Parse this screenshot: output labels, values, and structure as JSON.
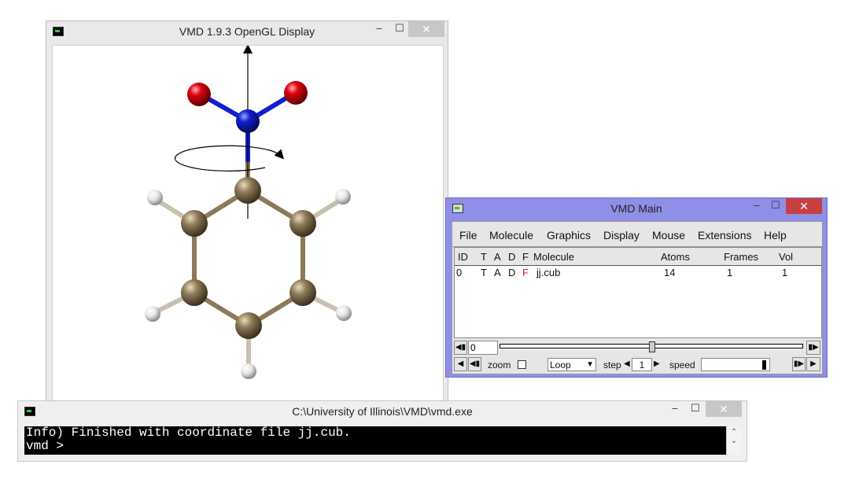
{
  "gl_window": {
    "title": "VMD 1.9.3 OpenGL Display",
    "controls": {
      "minimize": "–",
      "maximize": "☐",
      "close": "✕"
    }
  },
  "main_window": {
    "title": "VMD Main",
    "controls": {
      "minimize": "–",
      "maximize": "☐",
      "close": "✕"
    },
    "menu": [
      "File",
      "Molecule",
      "Graphics",
      "Display",
      "Mouse",
      "Extensions",
      "Help"
    ],
    "columns": {
      "id": "ID",
      "t": "T",
      "a": "A",
      "d": "D",
      "f": "F",
      "molecule": "Molecule",
      "atoms": "Atoms",
      "frames": "Frames",
      "vol": "Vol"
    },
    "rows": [
      {
        "id": "0",
        "t": "T",
        "a": "A",
        "d": "D",
        "f": "F",
        "molecule": "jj.cub",
        "atoms": "14",
        "frames": "1",
        "vol": "1"
      }
    ],
    "frame_value": "0",
    "zoom_label": "zoom",
    "loop_value": "Loop",
    "step_label": "step",
    "step_value": "1",
    "speed_label": "speed",
    "colors": {
      "title_bar": "#8f8fe8",
      "f_flag": "#e02020"
    }
  },
  "console_window": {
    "title": "C:\\University of Illinois\\VMD\\vmd.exe",
    "controls": {
      "minimize": "–",
      "maximize": "☐",
      "close": "✕"
    },
    "lines": [
      "Info) Finished with coordinate file jj.cub.",
      "vmd >"
    ]
  },
  "molecule_colors": {
    "oxygen": "#e0000f",
    "nitrogen": "#1020d0",
    "carbon": "#8c7a58",
    "hydrogen": "#f2f2f2"
  }
}
